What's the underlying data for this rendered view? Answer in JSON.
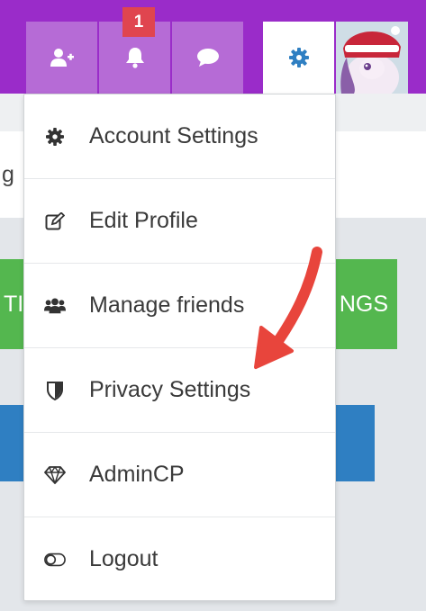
{
  "header": {
    "notification_count": "1"
  },
  "background": {
    "fragment_left": "g",
    "green_left_text": "TI",
    "green_right_text": "NGS"
  },
  "menu": {
    "items": [
      {
        "label": "Account Settings",
        "icon": "gear-icon"
      },
      {
        "label": "Edit Profile",
        "icon": "edit-icon"
      },
      {
        "label": "Manage friends",
        "icon": "users-icon"
      },
      {
        "label": "Privacy Settings",
        "icon": "shield-icon"
      },
      {
        "label": "AdminCP",
        "icon": "diamond-icon"
      },
      {
        "label": "Logout",
        "icon": "toggle-icon"
      }
    ]
  },
  "colors": {
    "header_bg": "#9a2cc9",
    "nav_button_bg": "#b66bd6",
    "badge_bg": "#e0454f",
    "gear_accent": "#2f7fc2",
    "annotation_arrow": "#e8453c"
  }
}
